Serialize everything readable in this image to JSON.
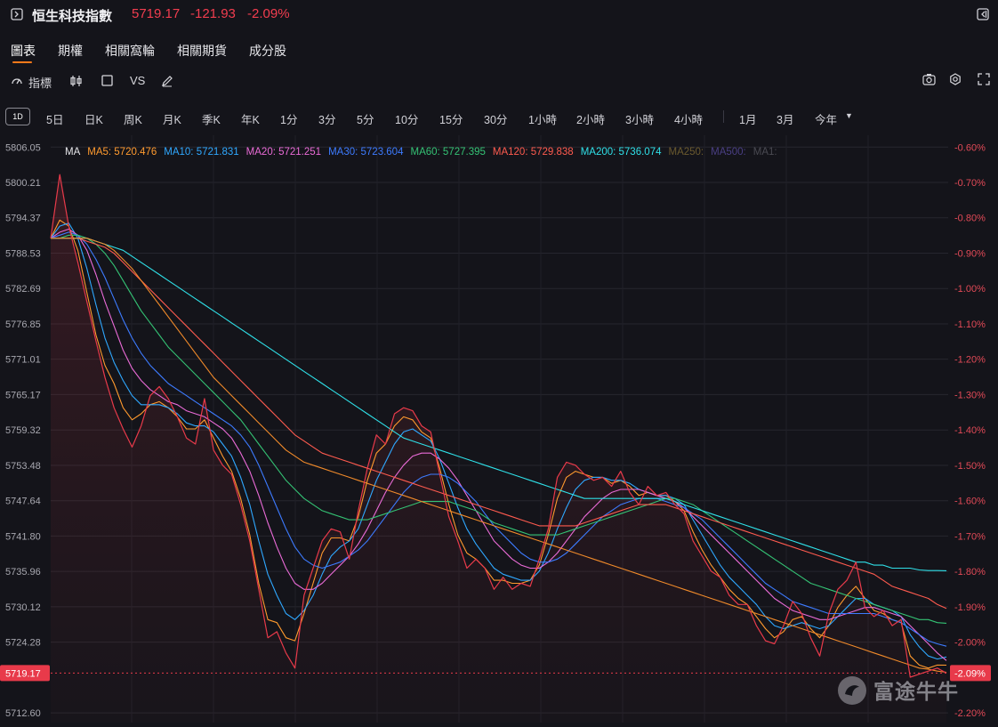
{
  "header": {
    "title": "恒生科技指數",
    "price": "5719.17",
    "change": "-121.93",
    "change_pct": "-2.09%",
    "up_color": "#f23d4f"
  },
  "tabs": [
    {
      "label": "圖表",
      "active": true
    },
    {
      "label": "期權",
      "active": false
    },
    {
      "label": "相關窩輪",
      "active": false
    },
    {
      "label": "相關期貨",
      "active": false
    },
    {
      "label": "成分股",
      "active": false
    }
  ],
  "toolbar": {
    "indicators_label": "指標",
    "vs_label": "VS",
    "icons": [
      "indicator-icon",
      "candlestick-icon",
      "square-icon",
      "draw-pen-icon",
      "camera-icon",
      "settings-icon",
      "fullscreen-icon"
    ]
  },
  "periods": {
    "selected": "1D",
    "items": [
      "5日",
      "日K",
      "周K",
      "月K",
      "季K",
      "年K",
      "1分",
      "3分",
      "5分",
      "10分",
      "15分",
      "30分",
      "1小時",
      "2小時",
      "3小時",
      "4小時",
      "1月",
      "3月",
      "今年"
    ]
  },
  "ma_legend": [
    {
      "label": "MA",
      "color": "#e6e6ea"
    },
    {
      "label": "MA5: 5720.476",
      "color": "#ff9a2e"
    },
    {
      "label": "MA10: 5721.831",
      "color": "#2fa8ff"
    },
    {
      "label": "MA20: 5721.251",
      "color": "#ea6bd7"
    },
    {
      "label": "MA30: 5723.604",
      "color": "#3d7bff"
    },
    {
      "label": "MA60: 5727.395",
      "color": "#34c274"
    },
    {
      "label": "MA120: 5729.838",
      "color": "#ff5b4f"
    },
    {
      "label": "MA200: 5736.074",
      "color": "#2fe0e8"
    },
    {
      "label": "MA250:",
      "color": "#6b5a2e"
    },
    {
      "label": "MA500:",
      "color": "#4a3f84"
    },
    {
      "label": "MA1:",
      "color": "#4a4a52"
    }
  ],
  "chart_data": {
    "type": "line",
    "ylim": [
      5711.0,
      5808.0
    ],
    "y_ticks_left": [
      "5806.05",
      "5800.21",
      "5794.37",
      "5788.53",
      "5782.69",
      "5776.85",
      "5771.01",
      "5765.17",
      "5759.32",
      "5753.48",
      "5747.64",
      "5741.80",
      "5735.96",
      "5730.12",
      "5724.28",
      "5712.60"
    ],
    "y_ticks_right": [
      "-0.60%",
      "-0.70%",
      "-0.80%",
      "-0.90%",
      "-1.00%",
      "-1.10%",
      "-1.20%",
      "-1.30%",
      "-1.40%",
      "-1.50%",
      "-1.60%",
      "-1.70%",
      "-1.80%",
      "-1.90%",
      "-2.00%",
      "-2.20%"
    ],
    "last_price_label": "5719.17",
    "last_pct_label": "-2.09%",
    "grid": true,
    "series": [
      {
        "key": "price",
        "color": "#e83a4a",
        "values": [
          5791.0,
          5801.5,
          5793.0,
          5787.0,
          5780.5,
          5774.0,
          5768.0,
          5763.0,
          5759.5,
          5756.5,
          5760.0,
          5765.0,
          5766.5,
          5764.5,
          5761.5,
          5758.0,
          5757.0,
          5764.5,
          5756.0,
          5753.5,
          5752.0,
          5747.0,
          5741.0,
          5733.0,
          5725.0,
          5726.0,
          5722.5,
          5720.0,
          5732.0,
          5736.5,
          5741.0,
          5743.0,
          5742.5,
          5738.0,
          5746.0,
          5753.0,
          5758.5,
          5757.0,
          5762.0,
          5763.0,
          5762.5,
          5760.0,
          5759.0,
          5752.0,
          5745.0,
          5741.0,
          5736.5,
          5738.0,
          5736.5,
          5733.0,
          5735.0,
          5733.0,
          5734.0,
          5733.5,
          5738.0,
          5743.0,
          5751.5,
          5754.0,
          5753.5,
          5752.0,
          5751.0,
          5751.5,
          5750.0,
          5752.5,
          5749.0,
          5747.0,
          5750.0,
          5748.5,
          5749.0,
          5747.0,
          5745.5,
          5741.0,
          5738.5,
          5736.0,
          5735.0,
          5732.0,
          5730.5,
          5730.5,
          5727.0,
          5724.5,
          5724.0,
          5727.0,
          5731.0,
          5729.0,
          5725.0,
          5722.0,
          5729.0,
          5733.0,
          5734.5,
          5737.5,
          5730.0,
          5728.5,
          5729.5,
          5727.0,
          5728.0,
          5718.5,
          5719.0,
          5719.5,
          5720.0,
          5719.17
        ]
      },
      {
        "key": "ma5",
        "color": "#ff9a2e",
        "values": [
          5791.0,
          5794.0,
          5793.0,
          5789.0,
          5782.0,
          5775.0,
          5770.0,
          5767.0,
          5763.0,
          5761.0,
          5762.0,
          5763.5,
          5764.0,
          5763.0,
          5761.5,
          5759.5,
          5759.5,
          5761.0,
          5758.0,
          5755.0,
          5752.5,
          5748.0,
          5742.0,
          5734.0,
          5728.0,
          5727.5,
          5725.0,
          5724.5,
          5729.0,
          5734.0,
          5739.0,
          5741.5,
          5741.5,
          5741.0,
          5745.0,
          5751.0,
          5755.5,
          5757.0,
          5760.0,
          5761.5,
          5761.0,
          5759.0,
          5758.0,
          5753.0,
          5747.0,
          5742.0,
          5739.0,
          5738.0,
          5736.5,
          5734.5,
          5734.5,
          5734.0,
          5734.0,
          5734.5,
          5737.0,
          5742.0,
          5748.0,
          5751.5,
          5752.5,
          5752.0,
          5751.5,
          5751.5,
          5750.5,
          5751.0,
          5750.0,
          5748.5,
          5749.0,
          5748.5,
          5748.5,
          5747.5,
          5746.0,
          5742.5,
          5739.5,
          5737.0,
          5735.0,
          5733.0,
          5731.5,
          5730.5,
          5728.5,
          5726.5,
          5725.0,
          5726.0,
          5728.0,
          5728.5,
          5726.5,
          5725.0,
          5727.0,
          5730.0,
          5732.0,
          5733.5,
          5731.5,
          5729.5,
          5729.0,
          5728.0,
          5727.5,
          5722.0,
          5720.5,
          5720.0,
          5720.5,
          5720.476
        ]
      },
      {
        "key": "ma10",
        "color": "#2fa8ff",
        "values": [
          5791.0,
          5793.0,
          5793.5,
          5791.0,
          5786.0,
          5780.0,
          5774.5,
          5770.5,
          5767.5,
          5765.0,
          5763.5,
          5763.5,
          5763.5,
          5763.0,
          5762.0,
          5760.5,
          5760.0,
          5760.0,
          5759.0,
          5757.0,
          5755.0,
          5751.5,
          5747.0,
          5741.0,
          5735.5,
          5732.0,
          5729.0,
          5728.0,
          5729.5,
          5732.0,
          5735.5,
          5738.5,
          5740.0,
          5741.0,
          5743.0,
          5747.0,
          5751.0,
          5754.0,
          5757.0,
          5759.0,
          5759.5,
          5758.5,
          5757.5,
          5754.5,
          5750.5,
          5746.5,
          5743.0,
          5740.5,
          5738.5,
          5736.5,
          5735.5,
          5735.0,
          5734.5,
          5734.5,
          5736.0,
          5739.0,
          5743.0,
          5746.5,
          5749.5,
          5751.0,
          5751.5,
          5751.5,
          5751.0,
          5751.0,
          5750.5,
          5749.5,
          5749.0,
          5748.5,
          5748.5,
          5748.0,
          5747.0,
          5744.5,
          5742.0,
          5739.5,
          5737.0,
          5735.0,
          5733.5,
          5732.0,
          5730.5,
          5728.5,
          5727.0,
          5726.5,
          5727.0,
          5727.5,
          5727.0,
          5726.5,
          5727.0,
          5728.5,
          5730.0,
          5731.5,
          5731.5,
          5730.5,
          5730.0,
          5729.5,
          5728.5,
          5725.5,
          5723.5,
          5722.0,
          5721.5,
          5721.831
        ]
      },
      {
        "key": "ma20",
        "color": "#ea6bd7",
        "values": [
          5791.0,
          5792.0,
          5792.5,
          5791.5,
          5789.0,
          5785.0,
          5780.5,
          5776.5,
          5772.5,
          5769.5,
          5767.5,
          5766.0,
          5765.0,
          5764.0,
          5763.5,
          5762.5,
          5762.0,
          5761.5,
          5760.5,
          5759.5,
          5758.0,
          5755.5,
          5752.5,
          5748.5,
          5744.0,
          5740.0,
          5736.5,
          5734.0,
          5733.0,
          5733.0,
          5734.0,
          5735.5,
          5737.0,
          5738.5,
          5740.5,
          5743.0,
          5746.0,
          5749.0,
          5751.5,
          5753.5,
          5755.0,
          5755.5,
          5755.5,
          5754.5,
          5753.0,
          5751.0,
          5748.5,
          5746.0,
          5743.5,
          5741.0,
          5739.5,
          5738.0,
          5737.0,
          5736.5,
          5736.5,
          5737.5,
          5739.0,
          5741.0,
          5743.0,
          5745.0,
          5746.5,
          5748.0,
          5749.0,
          5749.5,
          5749.5,
          5749.5,
          5749.0,
          5748.5,
          5748.0,
          5747.5,
          5746.5,
          5745.0,
          5743.5,
          5742.0,
          5740.5,
          5739.0,
          5737.5,
          5736.0,
          5734.5,
          5733.0,
          5731.5,
          5730.5,
          5729.5,
          5729.0,
          5728.5,
          5728.0,
          5728.0,
          5728.5,
          5729.0,
          5729.5,
          5730.0,
          5730.0,
          5729.5,
          5729.0,
          5728.5,
          5727.0,
          5725.5,
          5724.0,
          5722.5,
          5721.251
        ]
      },
      {
        "key": "ma30",
        "color": "#3d7bff",
        "values": [
          5791.0,
          5791.5,
          5792.0,
          5791.5,
          5790.0,
          5787.5,
          5784.5,
          5781.0,
          5777.5,
          5774.5,
          5772.0,
          5770.0,
          5768.5,
          5767.0,
          5766.0,
          5765.0,
          5764.0,
          5763.0,
          5762.0,
          5761.0,
          5760.0,
          5758.5,
          5756.5,
          5753.5,
          5750.0,
          5746.5,
          5743.0,
          5740.0,
          5738.0,
          5737.0,
          5736.5,
          5737.0,
          5737.5,
          5738.5,
          5739.5,
          5741.0,
          5743.0,
          5745.0,
          5747.0,
          5749.0,
          5750.5,
          5751.5,
          5752.0,
          5752.0,
          5751.5,
          5750.5,
          5749.0,
          5747.5,
          5745.5,
          5743.5,
          5742.0,
          5740.5,
          5739.0,
          5738.0,
          5737.5,
          5737.5,
          5738.0,
          5739.0,
          5740.5,
          5742.0,
          5743.5,
          5745.0,
          5746.0,
          5747.0,
          5747.5,
          5748.0,
          5748.0,
          5748.0,
          5747.5,
          5747.0,
          5746.5,
          5745.5,
          5744.5,
          5743.0,
          5741.5,
          5740.0,
          5738.5,
          5737.0,
          5735.5,
          5734.0,
          5733.0,
          5732.0,
          5731.0,
          5730.5,
          5730.0,
          5729.5,
          5729.0,
          5729.0,
          5729.0,
          5729.0,
          5729.0,
          5729.0,
          5728.5,
          5728.0,
          5727.5,
          5726.5,
          5725.5,
          5724.5,
          5724.0,
          5723.604
        ]
      },
      {
        "key": "ma60",
        "color": "#34c274",
        "values": [
          5791.0,
          5791.0,
          5791.5,
          5791.5,
          5791.0,
          5790.0,
          5788.5,
          5786.5,
          5784.0,
          5781.5,
          5779.0,
          5777.0,
          5775.0,
          5773.0,
          5771.5,
          5770.0,
          5768.5,
          5767.0,
          5765.5,
          5764.0,
          5762.5,
          5761.0,
          5759.0,
          5757.0,
          5755.0,
          5753.0,
          5751.0,
          5749.5,
          5748.0,
          5747.0,
          5746.0,
          5745.5,
          5745.0,
          5744.5,
          5744.5,
          5744.5,
          5745.0,
          5745.5,
          5746.0,
          5746.5,
          5747.0,
          5747.5,
          5747.5,
          5747.5,
          5747.5,
          5747.0,
          5746.5,
          5746.0,
          5745.0,
          5744.0,
          5743.5,
          5743.0,
          5742.5,
          5742.0,
          5742.0,
          5742.0,
          5742.0,
          5742.5,
          5743.0,
          5743.5,
          5744.0,
          5744.5,
          5745.0,
          5745.5,
          5746.0,
          5746.5,
          5747.0,
          5747.5,
          5748.0,
          5748.0,
          5747.5,
          5747.0,
          5746.0,
          5745.0,
          5744.0,
          5743.0,
          5742.0,
          5741.0,
          5740.0,
          5739.0,
          5738.0,
          5737.0,
          5736.0,
          5735.0,
          5734.0,
          5733.5,
          5733.0,
          5732.5,
          5732.0,
          5731.5,
          5731.0,
          5730.5,
          5730.0,
          5729.5,
          5729.0,
          5728.5,
          5728.0,
          5728.0,
          5727.5,
          5727.395
        ]
      },
      {
        "key": "ma120",
        "color": "#ff5b4f",
        "values": [
          5791.0,
          5791.0,
          5791.0,
          5791.0,
          5790.5,
          5790.0,
          5789.5,
          5788.5,
          5787.0,
          5785.5,
          5784.0,
          5782.5,
          5781.0,
          5779.5,
          5778.0,
          5776.5,
          5775.0,
          5773.5,
          5772.0,
          5770.5,
          5769.0,
          5767.5,
          5766.0,
          5764.5,
          5763.0,
          5761.5,
          5760.0,
          5758.5,
          5757.5,
          5756.5,
          5755.5,
          5755.0,
          5754.5,
          5754.0,
          5753.5,
          5753.0,
          5752.5,
          5752.0,
          5751.5,
          5751.0,
          5750.5,
          5750.0,
          5749.5,
          5749.0,
          5748.5,
          5748.0,
          5747.5,
          5747.0,
          5746.5,
          5746.0,
          5745.5,
          5745.0,
          5744.5,
          5744.0,
          5743.5,
          5743.5,
          5743.5,
          5743.5,
          5743.5,
          5744.0,
          5744.5,
          5745.0,
          5745.5,
          5746.0,
          5746.5,
          5747.0,
          5747.0,
          5747.0,
          5747.0,
          5746.5,
          5746.0,
          5745.5,
          5745.0,
          5744.5,
          5744.0,
          5743.5,
          5743.0,
          5742.5,
          5742.0,
          5741.5,
          5741.0,
          5740.5,
          5740.0,
          5739.5,
          5739.0,
          5738.5,
          5738.0,
          5737.5,
          5737.0,
          5736.5,
          5736.0,
          5735.5,
          5734.5,
          5733.5,
          5733.0,
          5732.5,
          5732.0,
          5731.5,
          5730.5,
          5729.838
        ]
      },
      {
        "key": "ma200",
        "color": "#2fe0e8",
        "values": [
          5791.0,
          5791.0,
          5791.0,
          5791.0,
          5791.0,
          5790.5,
          5790.0,
          5789.5,
          5789.0,
          5788.0,
          5787.0,
          5786.0,
          5785.0,
          5784.0,
          5783.0,
          5782.0,
          5781.0,
          5780.0,
          5779.0,
          5778.0,
          5777.0,
          5776.0,
          5775.0,
          5774.0,
          5773.0,
          5772.0,
          5771.0,
          5770.0,
          5769.0,
          5768.0,
          5767.0,
          5766.0,
          5765.0,
          5764.0,
          5763.0,
          5762.0,
          5761.0,
          5760.0,
          5759.0,
          5758.0,
          5757.5,
          5757.0,
          5756.5,
          5756.0,
          5755.5,
          5755.0,
          5754.5,
          5754.0,
          5753.5,
          5753.0,
          5752.5,
          5752.0,
          5751.5,
          5751.0,
          5750.5,
          5750.0,
          5749.5,
          5749.0,
          5748.5,
          5748.0,
          5748.0,
          5748.0,
          5748.0,
          5748.0,
          5748.0,
          5748.0,
          5748.0,
          5748.0,
          5748.0,
          5747.5,
          5747.0,
          5746.5,
          5746.0,
          5745.5,
          5745.0,
          5744.5,
          5744.0,
          5743.5,
          5743.0,
          5742.5,
          5742.0,
          5741.5,
          5741.0,
          5740.5,
          5740.0,
          5739.5,
          5739.0,
          5738.5,
          5738.0,
          5737.5,
          5737.5,
          5737.0,
          5737.0,
          5736.5,
          5736.5,
          5736.5,
          5736.2,
          5736.1,
          5736.1,
          5736.074
        ]
      },
      {
        "key": "ma250_line",
        "color": "#f08a2a",
        "values": [
          5791.0,
          5791.0,
          5791.0,
          5791.0,
          5791.0,
          5790.5,
          5790.0,
          5789.0,
          5787.5,
          5786.0,
          5784.0,
          5782.0,
          5780.0,
          5778.0,
          5776.0,
          5774.0,
          5772.0,
          5770.0,
          5768.0,
          5766.5,
          5765.0,
          5763.5,
          5762.0,
          5760.5,
          5759.0,
          5757.5,
          5756.0,
          5755.0,
          5754.0,
          5753.5,
          5753.0,
          5752.5,
          5752.0,
          5751.5,
          5751.0,
          5750.5,
          5750.0,
          5749.5,
          5749.0,
          5748.5,
          5748.0,
          5747.5,
          5747.0,
          5746.5,
          5746.0,
          5745.5,
          5745.0,
          5744.5,
          5744.0,
          5743.5,
          5743.0,
          5742.5,
          5742.0,
          5741.5,
          5741.0,
          5740.5,
          5740.0,
          5739.5,
          5739.0,
          5738.5,
          5738.0,
          5737.5,
          5737.0,
          5736.5,
          5736.0,
          5735.5,
          5735.0,
          5734.5,
          5734.0,
          5733.5,
          5733.0,
          5732.5,
          5732.0,
          5731.5,
          5731.0,
          5730.5,
          5730.0,
          5729.5,
          5729.0,
          5728.5,
          5728.0,
          5727.5,
          5727.0,
          5726.5,
          5726.0,
          5725.5,
          5725.0,
          5724.5,
          5724.0,
          5723.5,
          5723.0,
          5722.5,
          5722.0,
          5721.5,
          5721.0,
          5720.5,
          5720.0,
          5719.8,
          5719.5,
          5719.3
        ]
      }
    ]
  },
  "watermark": "富途牛牛"
}
